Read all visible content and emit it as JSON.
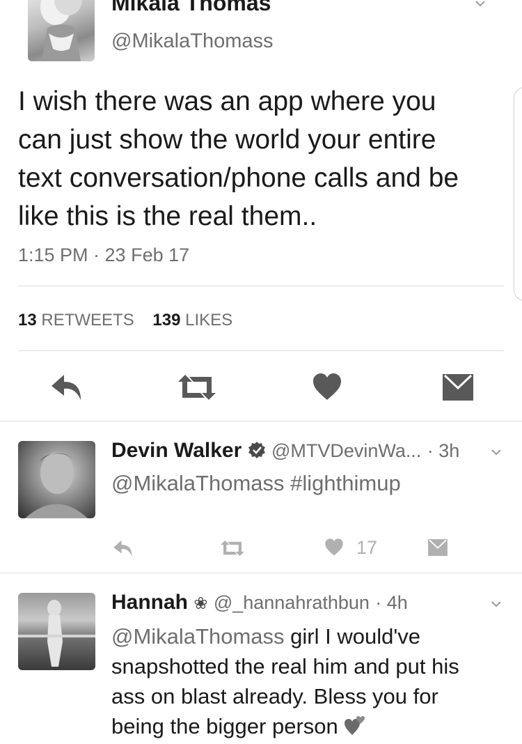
{
  "main_tweet": {
    "author_name": "Mikala Thomas",
    "handle": "@MikalaThomass",
    "text_lines": [
      "I wish there was an app where you",
      "can just show the world your entire",
      "text conversation/phone calls and be",
      "like this is the real them.."
    ],
    "timestamp": "1:15 PM · 23 Feb 17",
    "retweets_count": "13",
    "retweets_label": "RETWEETS",
    "likes_count": "139",
    "likes_label": "LIKES",
    "actions": [
      "reply-icon",
      "retweet-icon",
      "heart-icon",
      "message-icon"
    ]
  },
  "replies": [
    {
      "name": "Devin Walker",
      "badge": "verified-icon",
      "handle": "@MTVDevinWa...",
      "time": "· 3h",
      "mention": "@MikalaThomass",
      "text": " #lighthimup",
      "likes": "17"
    },
    {
      "name": "Hannah",
      "badge": "flower-icon",
      "handle": "@_hannahrathbun",
      "time": "· 4h",
      "mention": "@MikalaThomass",
      "text_lines": [
        " girl I would've",
        "snapshotted the real him and put his",
        "ass on blast already. Bless you for",
        "being the bigger person"
      ],
      "emoji": "hearts-emoji"
    }
  ]
}
